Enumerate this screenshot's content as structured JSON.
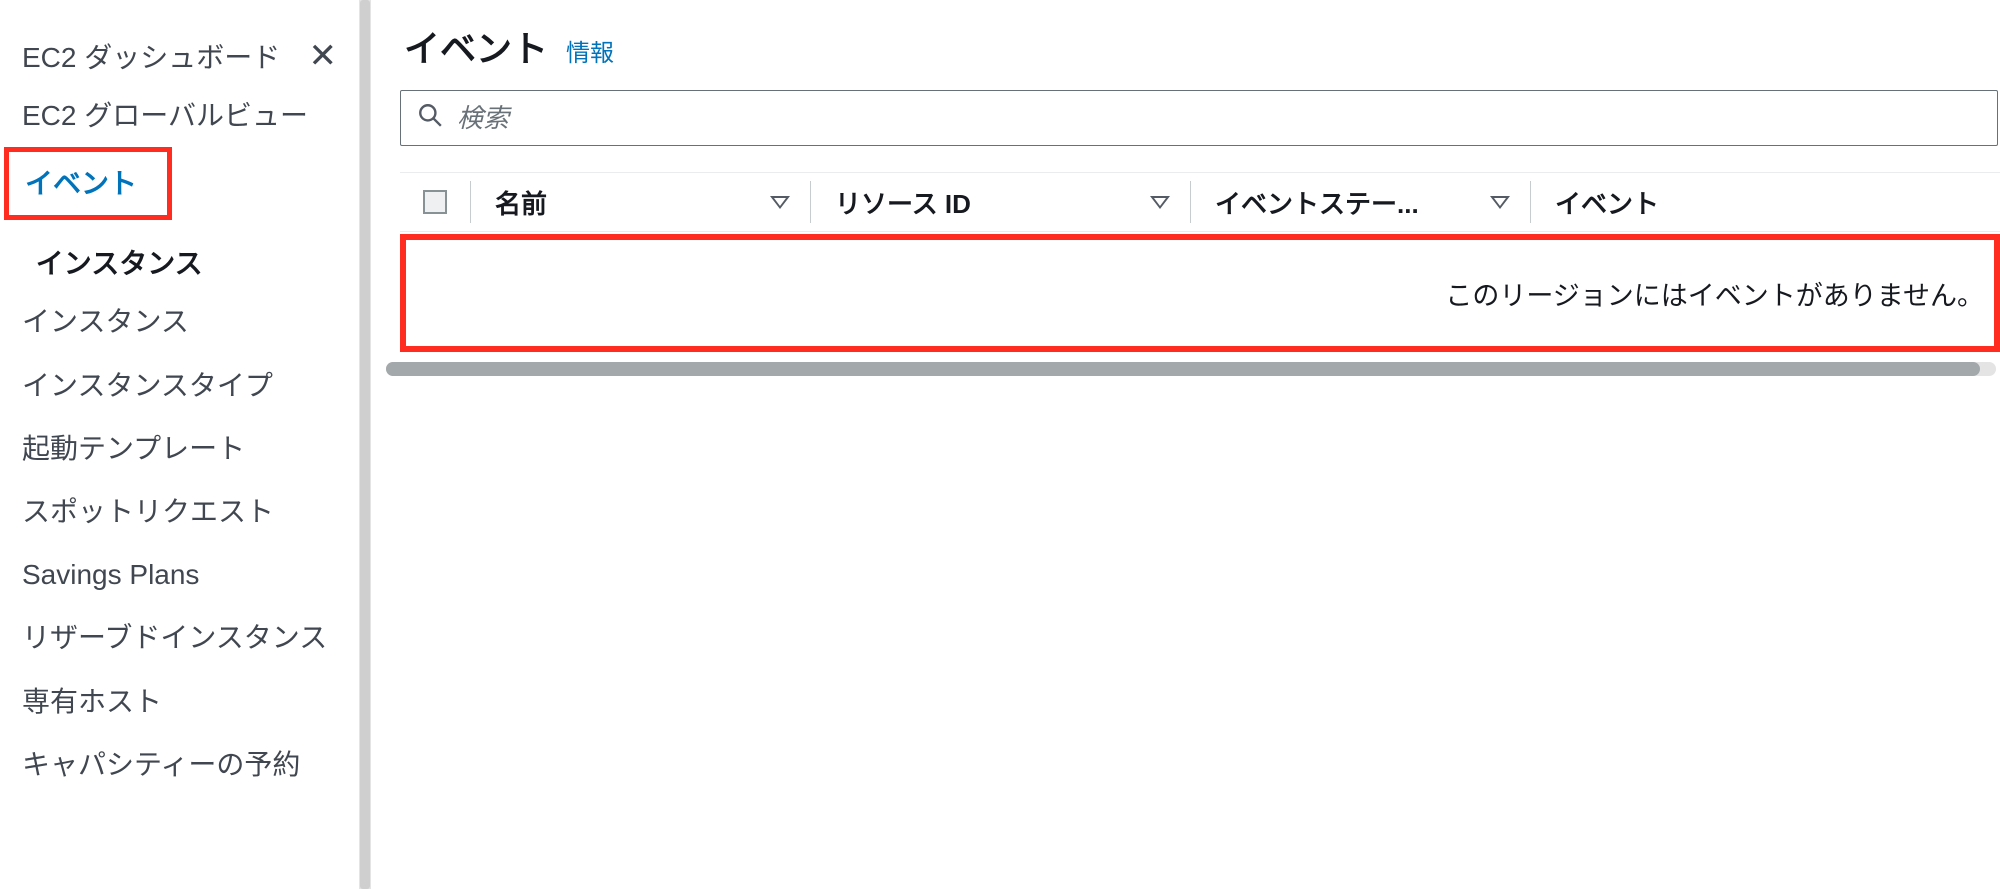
{
  "sidebar": {
    "top_item": "EC2 ダッシュボード",
    "items_pre_section": [
      "EC2 グローバルビュー",
      "イベント"
    ],
    "active_index": 1,
    "section_header": "インスタンス",
    "items_section": [
      "インスタンス",
      "インスタンスタイプ",
      "起動テンプレート",
      "スポットリクエスト",
      "Savings Plans",
      "リザーブドインスタンス",
      "専有ホスト",
      "キャパシティーの予約"
    ]
  },
  "page": {
    "title": "イベント",
    "info_label": "情報"
  },
  "search": {
    "placeholder": "検索",
    "value": ""
  },
  "table": {
    "columns": {
      "name": "名前",
      "resource_id": "リソース ID",
      "event_status": "イベントステー...",
      "event": "イベント"
    },
    "empty_message": "このリージョンにはイベントがありません。"
  }
}
